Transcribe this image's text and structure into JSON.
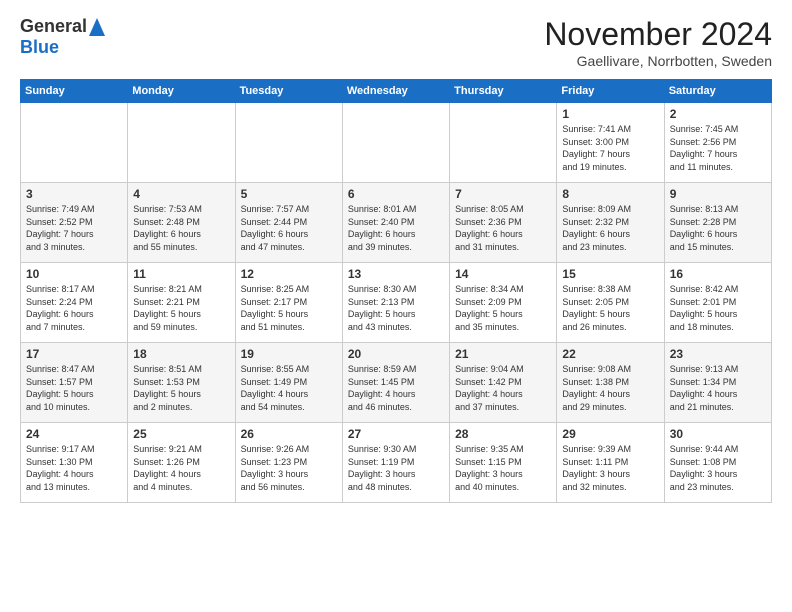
{
  "header": {
    "logo_general": "General",
    "logo_blue": "Blue",
    "month": "November 2024",
    "location": "Gaellivare, Norrbotten, Sweden"
  },
  "days_of_week": [
    "Sunday",
    "Monday",
    "Tuesday",
    "Wednesday",
    "Thursday",
    "Friday",
    "Saturday"
  ],
  "weeks": [
    [
      {
        "day": "",
        "info": ""
      },
      {
        "day": "",
        "info": ""
      },
      {
        "day": "",
        "info": ""
      },
      {
        "day": "",
        "info": ""
      },
      {
        "day": "",
        "info": ""
      },
      {
        "day": "1",
        "info": "Sunrise: 7:41 AM\nSunset: 3:00 PM\nDaylight: 7 hours\nand 19 minutes."
      },
      {
        "day": "2",
        "info": "Sunrise: 7:45 AM\nSunset: 2:56 PM\nDaylight: 7 hours\nand 11 minutes."
      }
    ],
    [
      {
        "day": "3",
        "info": "Sunrise: 7:49 AM\nSunset: 2:52 PM\nDaylight: 7 hours\nand 3 minutes."
      },
      {
        "day": "4",
        "info": "Sunrise: 7:53 AM\nSunset: 2:48 PM\nDaylight: 6 hours\nand 55 minutes."
      },
      {
        "day": "5",
        "info": "Sunrise: 7:57 AM\nSunset: 2:44 PM\nDaylight: 6 hours\nand 47 minutes."
      },
      {
        "day": "6",
        "info": "Sunrise: 8:01 AM\nSunset: 2:40 PM\nDaylight: 6 hours\nand 39 minutes."
      },
      {
        "day": "7",
        "info": "Sunrise: 8:05 AM\nSunset: 2:36 PM\nDaylight: 6 hours\nand 31 minutes."
      },
      {
        "day": "8",
        "info": "Sunrise: 8:09 AM\nSunset: 2:32 PM\nDaylight: 6 hours\nand 23 minutes."
      },
      {
        "day": "9",
        "info": "Sunrise: 8:13 AM\nSunset: 2:28 PM\nDaylight: 6 hours\nand 15 minutes."
      }
    ],
    [
      {
        "day": "10",
        "info": "Sunrise: 8:17 AM\nSunset: 2:24 PM\nDaylight: 6 hours\nand 7 minutes."
      },
      {
        "day": "11",
        "info": "Sunrise: 8:21 AM\nSunset: 2:21 PM\nDaylight: 5 hours\nand 59 minutes."
      },
      {
        "day": "12",
        "info": "Sunrise: 8:25 AM\nSunset: 2:17 PM\nDaylight: 5 hours\nand 51 minutes."
      },
      {
        "day": "13",
        "info": "Sunrise: 8:30 AM\nSunset: 2:13 PM\nDaylight: 5 hours\nand 43 minutes."
      },
      {
        "day": "14",
        "info": "Sunrise: 8:34 AM\nSunset: 2:09 PM\nDaylight: 5 hours\nand 35 minutes."
      },
      {
        "day": "15",
        "info": "Sunrise: 8:38 AM\nSunset: 2:05 PM\nDaylight: 5 hours\nand 26 minutes."
      },
      {
        "day": "16",
        "info": "Sunrise: 8:42 AM\nSunset: 2:01 PM\nDaylight: 5 hours\nand 18 minutes."
      }
    ],
    [
      {
        "day": "17",
        "info": "Sunrise: 8:47 AM\nSunset: 1:57 PM\nDaylight: 5 hours\nand 10 minutes."
      },
      {
        "day": "18",
        "info": "Sunrise: 8:51 AM\nSunset: 1:53 PM\nDaylight: 5 hours\nand 2 minutes."
      },
      {
        "day": "19",
        "info": "Sunrise: 8:55 AM\nSunset: 1:49 PM\nDaylight: 4 hours\nand 54 minutes."
      },
      {
        "day": "20",
        "info": "Sunrise: 8:59 AM\nSunset: 1:45 PM\nDaylight: 4 hours\nand 46 minutes."
      },
      {
        "day": "21",
        "info": "Sunrise: 9:04 AM\nSunset: 1:42 PM\nDaylight: 4 hours\nand 37 minutes."
      },
      {
        "day": "22",
        "info": "Sunrise: 9:08 AM\nSunset: 1:38 PM\nDaylight: 4 hours\nand 29 minutes."
      },
      {
        "day": "23",
        "info": "Sunrise: 9:13 AM\nSunset: 1:34 PM\nDaylight: 4 hours\nand 21 minutes."
      }
    ],
    [
      {
        "day": "24",
        "info": "Sunrise: 9:17 AM\nSunset: 1:30 PM\nDaylight: 4 hours\nand 13 minutes."
      },
      {
        "day": "25",
        "info": "Sunrise: 9:21 AM\nSunset: 1:26 PM\nDaylight: 4 hours\nand 4 minutes."
      },
      {
        "day": "26",
        "info": "Sunrise: 9:26 AM\nSunset: 1:23 PM\nDaylight: 3 hours\nand 56 minutes."
      },
      {
        "day": "27",
        "info": "Sunrise: 9:30 AM\nSunset: 1:19 PM\nDaylight: 3 hours\nand 48 minutes."
      },
      {
        "day": "28",
        "info": "Sunrise: 9:35 AM\nSunset: 1:15 PM\nDaylight: 3 hours\nand 40 minutes."
      },
      {
        "day": "29",
        "info": "Sunrise: 9:39 AM\nSunset: 1:11 PM\nDaylight: 3 hours\nand 32 minutes."
      },
      {
        "day": "30",
        "info": "Sunrise: 9:44 AM\nSunset: 1:08 PM\nDaylight: 3 hours\nand 23 minutes."
      }
    ]
  ]
}
